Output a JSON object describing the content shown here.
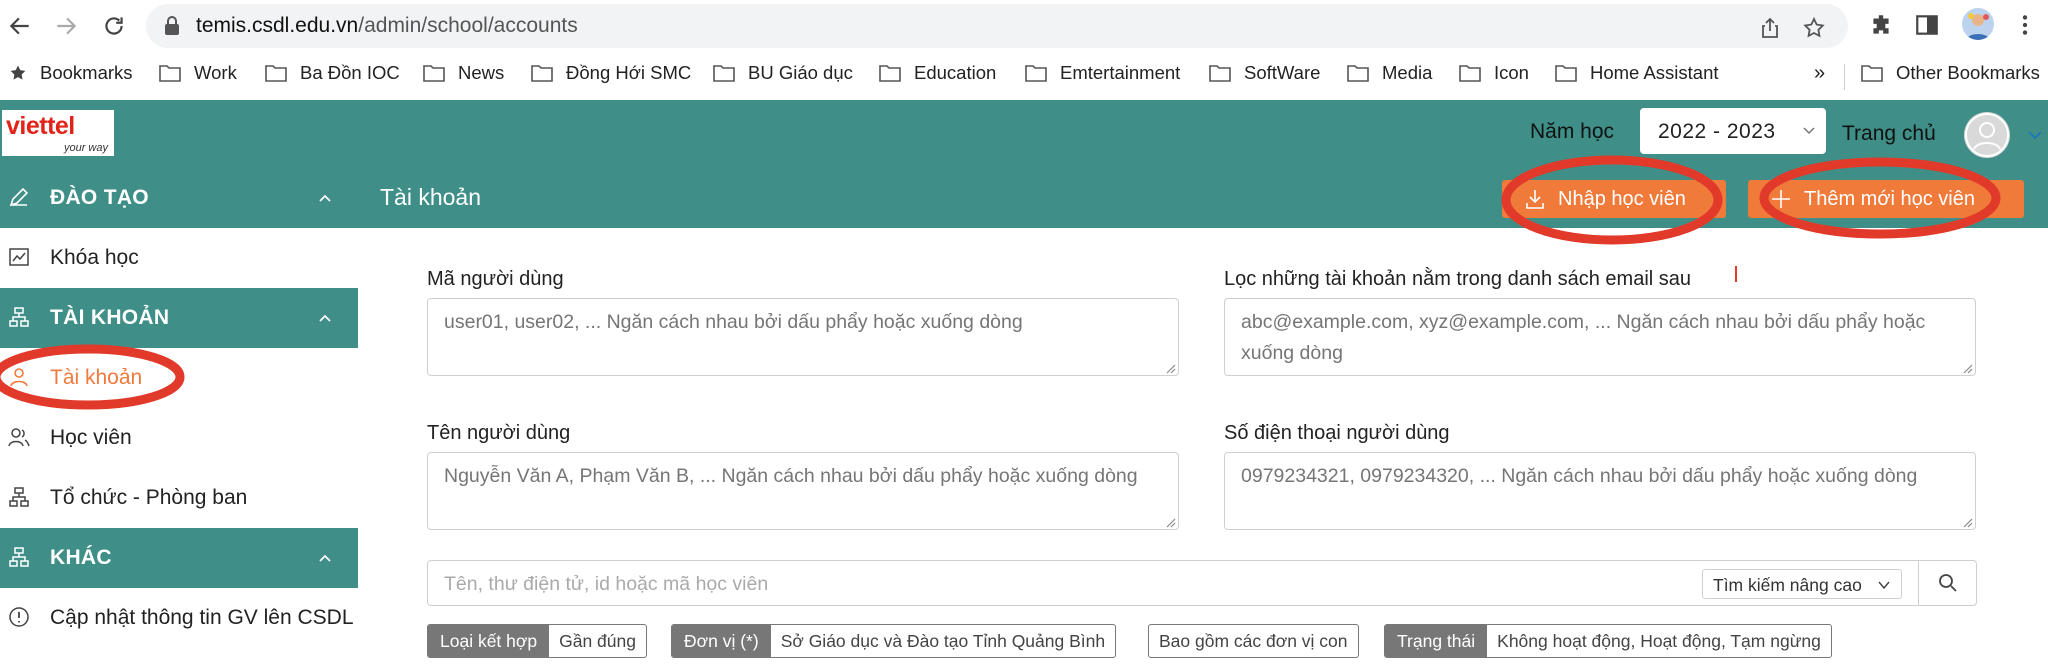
{
  "browser": {
    "url_host": "temis.csdl.edu.vn",
    "url_path": "/admin/school/accounts",
    "bookmarks": [
      "Bookmarks",
      "Work",
      "Ba Đồn IOC",
      "News",
      "Đồng Hới SMC",
      "BU Giáo dục",
      "Education",
      "Emtertainment",
      "SoftWare",
      "Media",
      "Icon",
      "Home Assistant"
    ],
    "overflow": "»",
    "other_bookmarks": "Other Bookmarks"
  },
  "header": {
    "logo_main": "viettel",
    "logo_sub": "your way",
    "year_label": "Năm học",
    "year_value": "2022 - 2023",
    "home_link": "Trang chủ"
  },
  "sidebar": {
    "sections": [
      {
        "title": "ĐÀO TẠO",
        "items": [
          "Khóa học"
        ]
      },
      {
        "title": "TÀI KHOẢN",
        "items": [
          "Tài khoản",
          "Học viên",
          "Tổ chức - Phòng ban"
        ]
      },
      {
        "title": "KHÁC",
        "items": [
          "Cập nhật thông tin GV lên CSDL"
        ]
      }
    ],
    "active_item": "Tài khoản"
  },
  "toolbar": {
    "page_title": "Tài khoản",
    "import_label": "Nhập học viên",
    "add_label": "Thêm mới học viên"
  },
  "filters": {
    "user_code_label": "Mã người dùng",
    "user_code_placeholder": "user01, user02, ... Ngăn cách nhau bởi dấu phẩy hoặc xuống dòng",
    "email_label": "Lọc những tài khoản nằm trong danh sách email sau",
    "email_placeholder": "abc@example.com, xyz@example.com, ... Ngăn cách nhau bởi dấu phẩy hoặc xuống dòng",
    "name_label": "Tên người dùng",
    "name_placeholder": "Nguyễn Văn A, Phạm Văn B, ... Ngăn cách nhau bởi dấu phẩy hoặc xuống dòng",
    "phone_label": "Số điện thoại người dùng",
    "phone_placeholder": "0979234321, 0979234320, ... Ngăn cách nhau bởi dấu phẩy hoặc xuống dòng",
    "search_placeholder": "Tên, thư điện tử, id hoặc mã học viên",
    "advanced_search": "Tìm kiếm nâng cao"
  },
  "chips": [
    {
      "key": "Loại kết hợp",
      "value": "Gần đúng"
    },
    {
      "key": "Đơn vị (*)",
      "value": "Sở Giáo dục và Đào tạo Tỉnh Quảng Bình"
    },
    {
      "key": "",
      "value": "Bao gồm các đơn vị con"
    },
    {
      "key": "Trạng thái",
      "value": "Không hoạt động, Hoạt động, Tạm ngừng"
    }
  ],
  "colors": {
    "teal": "#3f8f88",
    "orange": "#f07a3a",
    "annotation_red": "#e23a2a"
  }
}
